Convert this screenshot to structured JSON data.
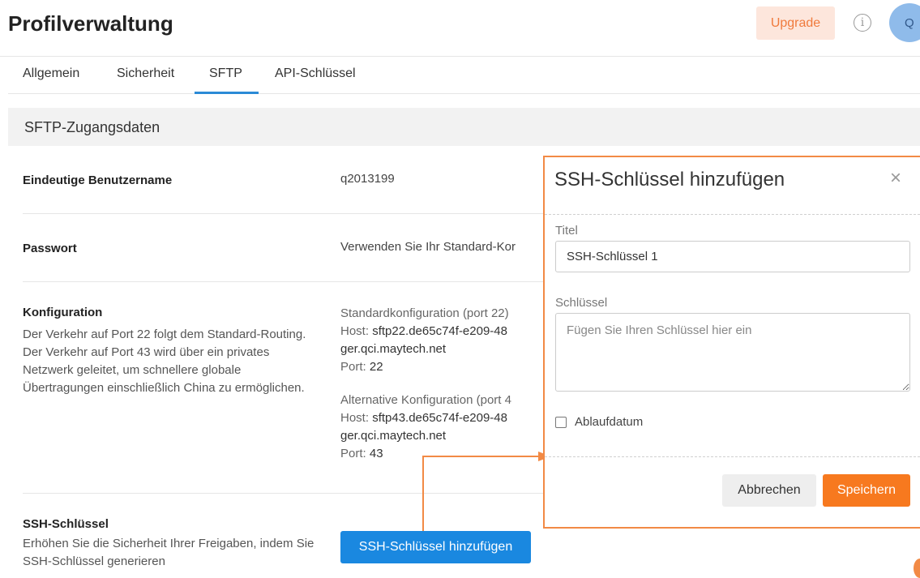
{
  "header": {
    "title": "Profilverwaltung",
    "upgrade_label": "Upgrade",
    "info_icon": "i",
    "avatar_initial": "Q"
  },
  "tabs": [
    {
      "label": "Allgemein",
      "active": false
    },
    {
      "label": "Sicherheit",
      "active": false
    },
    {
      "label": "SFTP",
      "active": true
    },
    {
      "label": "API-Schlüssel",
      "active": false
    }
  ],
  "section": {
    "title": "SFTP-Zugangsdaten"
  },
  "rows": {
    "username": {
      "label": "Eindeutige Benutzername",
      "value": "q2013199"
    },
    "password": {
      "label": "Passwort",
      "value": "Verwenden Sie Ihr Standard-Kor"
    },
    "config": {
      "label": "Konfiguration",
      "description": "Der Verkehr auf Port 22 folgt dem Standard-Routing. Der Verkehr auf Port 43 wird über ein privates Netzwerk geleitet, um schnellere globale Übertragungen einschließlich China zu ermöglichen.",
      "standard": {
        "title": "Standardkonfiguration (port 22)",
        "host_label": "Host:",
        "host_line1": "sftp22.de65c74f-e209-48",
        "host_line2": "ger.qci.maytech.net",
        "port_label": "Port:",
        "port": "22"
      },
      "alternative": {
        "title": "Alternative Konfiguration (port 4",
        "host_label": "Host:",
        "host_line1": "sftp43.de65c74f-e209-48",
        "host_line2": "ger.qci.maytech.net",
        "port_label": "Port:",
        "port": "43"
      }
    },
    "ssh": {
      "label": "SSH-Schlüssel",
      "description": "Erhöhen Sie die Sicherheit Ihrer Freigaben, indem Sie SSH-Schlüssel generieren",
      "button_label": "SSH-Schlüssel hinzufügen"
    }
  },
  "modal": {
    "title": "SSH-Schlüssel hinzufügen",
    "close_glyph": "×",
    "title_field_label": "Titel",
    "title_field_value": "SSH-Schlüssel 1",
    "key_field_label": "Schlüssel",
    "key_field_placeholder": "Fügen Sie Ihren Schlüssel hier ein",
    "expiry_label": "Ablaufdatum",
    "expiry_checked": false,
    "cancel_label": "Abbrechen",
    "save_label": "Speichern"
  },
  "colors": {
    "accent_blue": "#1a88e0",
    "accent_orange": "#f7791f",
    "annotation_orange": "#f28a45",
    "upgrade_bg": "#fde6dc"
  }
}
